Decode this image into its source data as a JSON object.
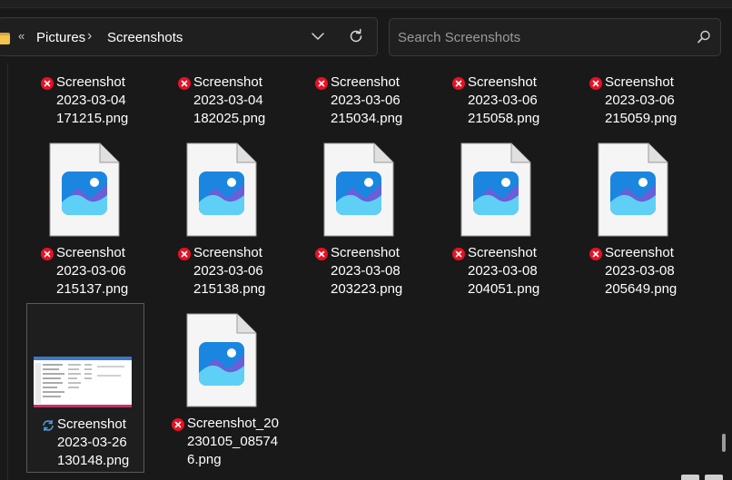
{
  "breadcrumb": {
    "overflow": "«",
    "items": [
      "Pictures",
      "Screenshots"
    ],
    "separator": "›"
  },
  "search": {
    "placeholder": "Search Screenshots"
  },
  "files": [
    {
      "name_lines": [
        "Screenshot",
        "2023-03-04",
        "171215.png"
      ],
      "status": "error",
      "thumb": "none"
    },
    {
      "name_lines": [
        "Screenshot",
        "2023-03-04",
        "182025.png"
      ],
      "status": "error",
      "thumb": "none"
    },
    {
      "name_lines": [
        "Screenshot",
        "2023-03-06",
        "215034.png"
      ],
      "status": "error",
      "thumb": "none"
    },
    {
      "name_lines": [
        "Screenshot",
        "2023-03-06",
        "215058.png"
      ],
      "status": "error",
      "thumb": "none"
    },
    {
      "name_lines": [
        "Screenshot",
        "2023-03-06",
        "215059.png"
      ],
      "status": "error",
      "thumb": "none"
    },
    {
      "name_lines": [
        "Screenshot",
        "2023-03-06",
        "215137.png"
      ],
      "status": "error",
      "thumb": "image-file-icon"
    },
    {
      "name_lines": [
        "Screenshot",
        "2023-03-06",
        "215138.png"
      ],
      "status": "error",
      "thumb": "image-file-icon"
    },
    {
      "name_lines": [
        "Screenshot",
        "2023-03-08",
        "203223.png"
      ],
      "status": "error",
      "thumb": "image-file-icon"
    },
    {
      "name_lines": [
        "Screenshot",
        "2023-03-08",
        "204051.png"
      ],
      "status": "error",
      "thumb": "image-file-icon"
    },
    {
      "name_lines": [
        "Screenshot",
        "2023-03-08",
        "205649.png"
      ],
      "status": "error",
      "thumb": "image-file-icon"
    },
    {
      "name_lines": [
        "Screenshot",
        "2023-03-26",
        "130148.png"
      ],
      "status": "syncing",
      "thumb": "screenshot-preview"
    },
    {
      "name_lines": [
        "Screenshot_20",
        "230105_08574",
        "6.png"
      ],
      "status": "error",
      "thumb": "image-file-icon"
    }
  ],
  "colors": {
    "error": "#e81123",
    "sync": "#4aa3f0",
    "folder": "#f4c44c",
    "background": "#191919"
  }
}
